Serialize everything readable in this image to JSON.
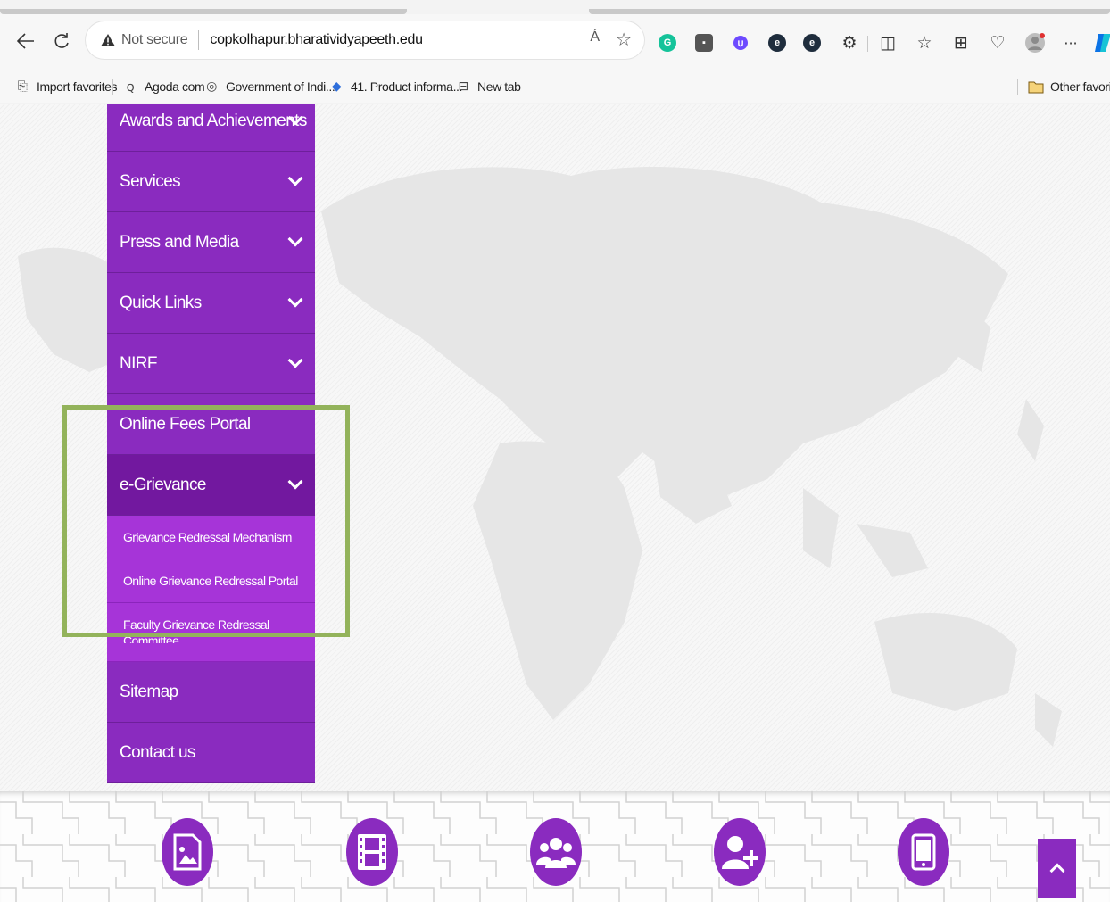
{
  "browser": {
    "address": {
      "security_label": "Not secure",
      "url": "copkolhapur.bharatividyapeeth.edu",
      "read_aloud": "Á"
    },
    "bookmarks": [
      {
        "label": "Import favorites",
        "icon": "import-icon"
      },
      {
        "label": "Agoda com",
        "icon": "agoda-icon"
      },
      {
        "label": "Government of Indi...",
        "icon": "emblem-icon"
      },
      {
        "label": "41. Product informa...",
        "icon": "diamond-icon"
      },
      {
        "label": "New tab",
        "icon": "newtab-icon"
      }
    ],
    "other_favorites": "Other favorite",
    "colors": {
      "grammarly": "#15c39a",
      "proton": "#6d4aff",
      "accent": "#0b73e6"
    }
  },
  "menu": {
    "items": [
      {
        "label": "Awards and Achievements",
        "has_submenu": true
      },
      {
        "label": "Services",
        "has_submenu": true
      },
      {
        "label": "Press and Media",
        "has_submenu": true
      },
      {
        "label": "Quick Links",
        "has_submenu": true
      },
      {
        "label": "NIRF",
        "has_submenu": true
      },
      {
        "label": "Online Fees Portal",
        "has_submenu": false
      },
      {
        "label": "e-Grievance",
        "has_submenu": true,
        "expanded": true
      },
      {
        "label": "Sitemap",
        "has_submenu": false
      },
      {
        "label": "Contact us",
        "has_submenu": false
      }
    ],
    "e_grievance_submenu": [
      "Grievance Redressal Mechanism",
      "Online Grievance Redressal Portal",
      "Faculty Grievance Redressal Committee"
    ],
    "colors": {
      "menu": "#8a2bbf",
      "active": "#72189f",
      "submenu": "#a634d8",
      "highlight_box": "#93b35b"
    }
  },
  "footer": {
    "icons": [
      "photo-gallery-icon",
      "video-film-icon",
      "group-users-icon",
      "add-user-icon",
      "mobile-tablet-icon"
    ],
    "scroll_top_icon": "chevron-up-icon"
  }
}
